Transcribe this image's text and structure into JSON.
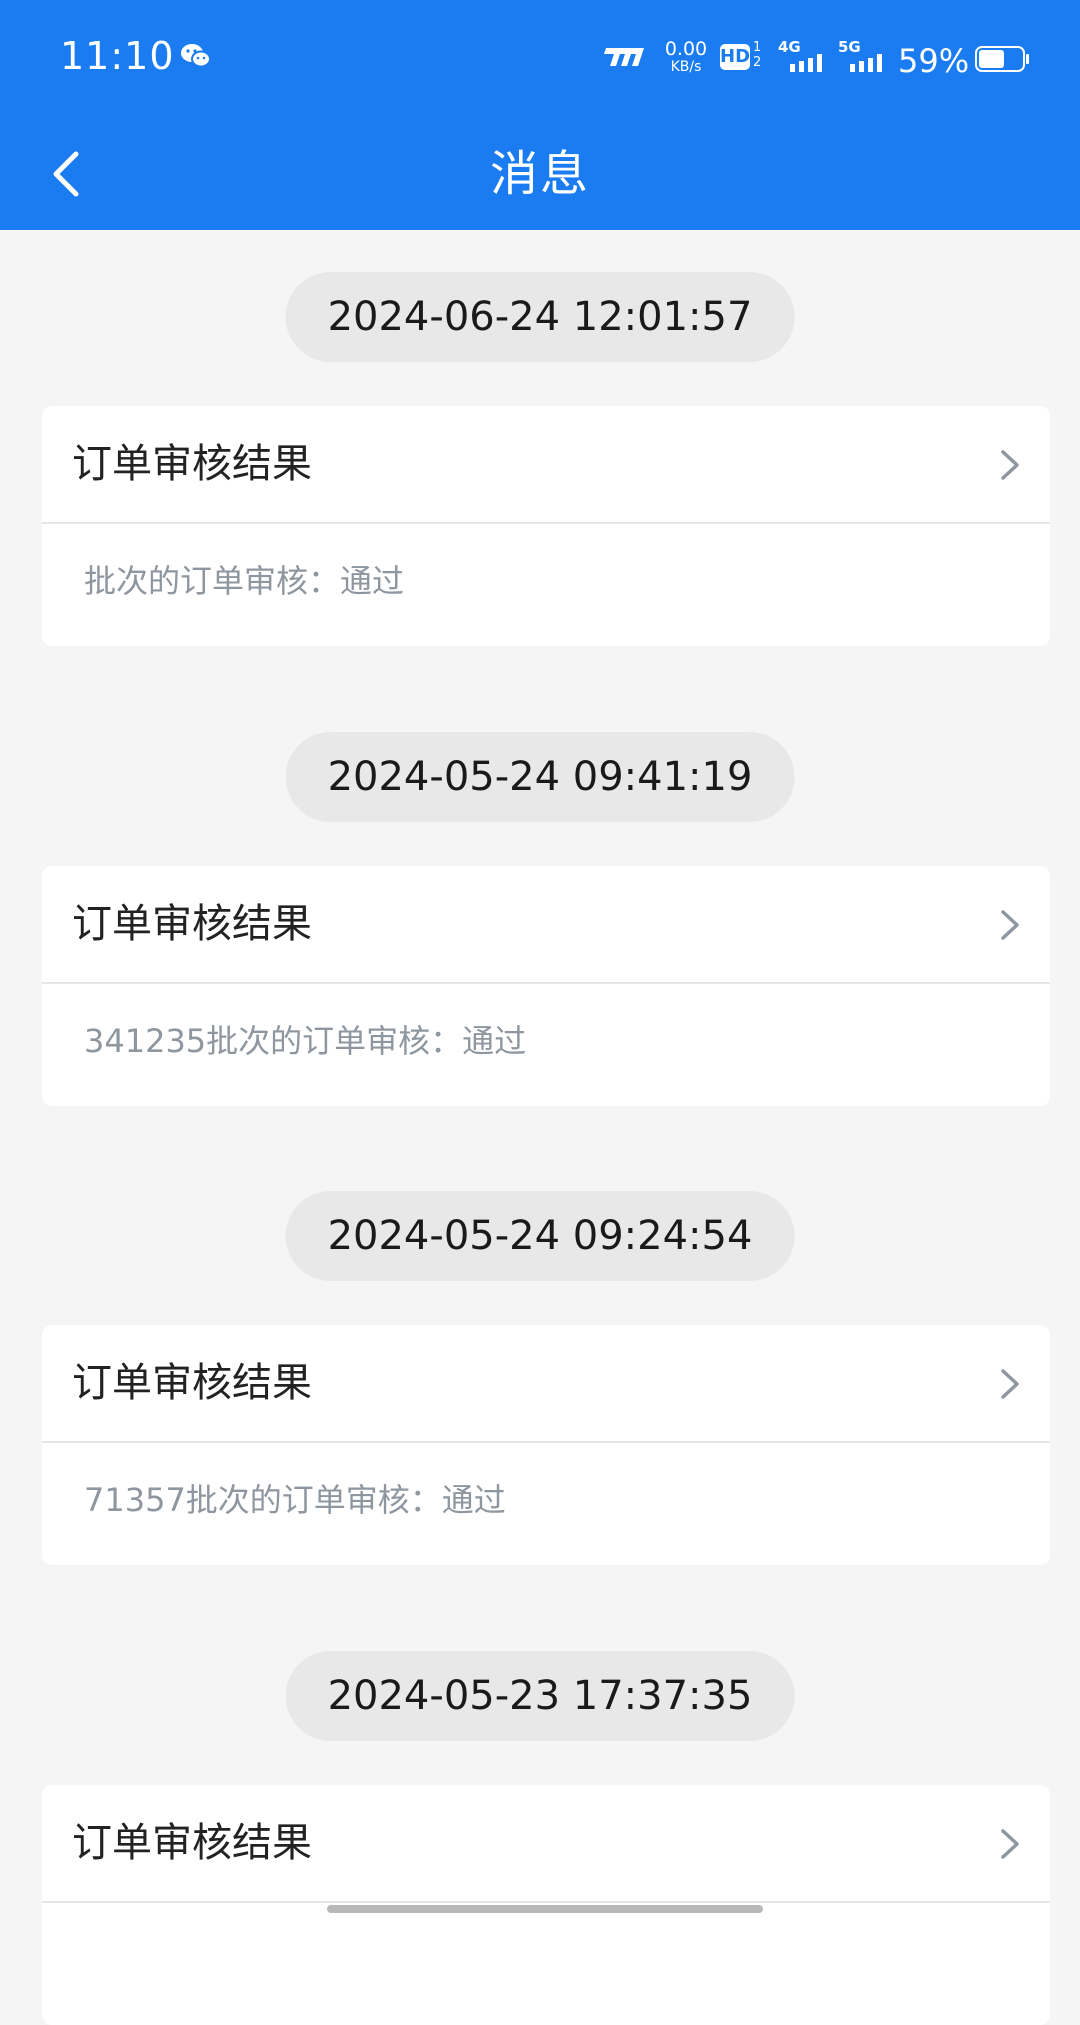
{
  "status_bar": {
    "time": "11:10",
    "speed_value": "0.00",
    "speed_unit": "KB/s",
    "hd_label": "HD",
    "sim1_network": "4G",
    "sim2_network": "5G",
    "battery_percent": "59%",
    "battery_level": 0.59
  },
  "nav": {
    "title": "消息"
  },
  "messages": [
    {
      "timestamp": "2024-06-24 12:01:57",
      "title": "订单审核结果",
      "body": "批次的订单审核：通过"
    },
    {
      "timestamp": "2024-05-24 09:41:19",
      "title": "订单审核结果",
      "body": "341235批次的订单审核：通过"
    },
    {
      "timestamp": "2024-05-24 09:24:54",
      "title": "订单审核结果",
      "body": "71357批次的订单审核：通过"
    },
    {
      "timestamp": "2024-05-23 17:37:35",
      "title": "订单审核结果",
      "body": ""
    }
  ],
  "colors": {
    "header_blue": "#1a7cf0",
    "page_background": "#f5f5f5",
    "body_text_gray": "#8e97a0"
  }
}
